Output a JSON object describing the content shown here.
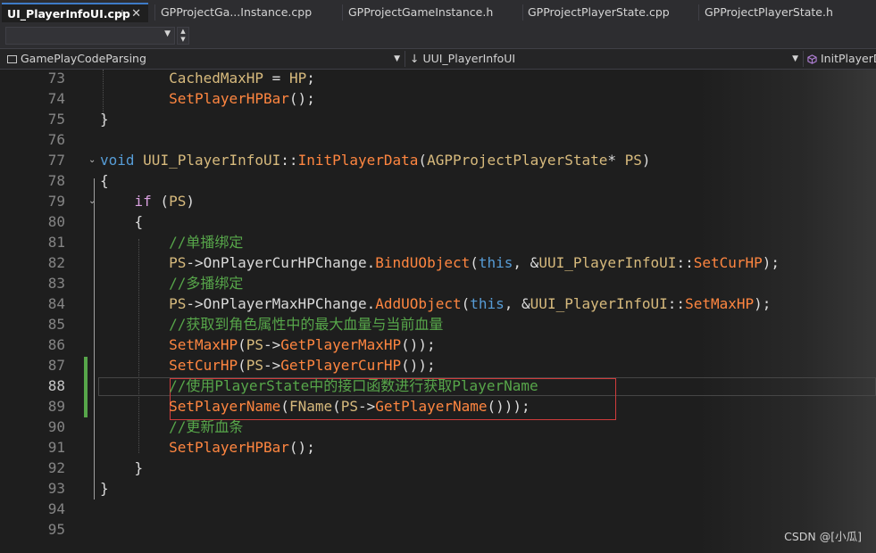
{
  "tabs": [
    {
      "label": "UI_PlayerInfoUI.cpp",
      "active": true
    },
    {
      "label": "GPProjectGa...Instance.cpp"
    },
    {
      "label": "GPProjectGameInstance.h"
    },
    {
      "label": "GPProjectPlayerState.cpp"
    },
    {
      "label": "GPProjectPlayerState.h"
    }
  ],
  "tab_icons": {
    "pin": "⊣",
    "close": "✕"
  },
  "navbar": {
    "project": "GamePlayCodeParsing",
    "scope": "↓ UUI_PlayerInfoUI",
    "member": "InitPlayerD"
  },
  "editor": {
    "lines": [
      {
        "n": "73",
        "tokens": [
          [
            "",
            "        "
          ],
          [
            "t-var",
            "CachedMaxHP"
          ],
          [
            "",
            " = "
          ],
          [
            "t-var",
            "HP"
          ],
          [
            "",
            ";"
          ]
        ]
      },
      {
        "n": "74",
        "tokens": [
          [
            "",
            "        "
          ],
          [
            "t-fn",
            "SetPlayerHPBar"
          ],
          [
            "",
            "();"
          ]
        ]
      },
      {
        "n": "75",
        "tokens": [
          [
            "",
            "}"
          ]
        ]
      },
      {
        "n": "76",
        "tokens": []
      },
      {
        "n": "77",
        "fold": true,
        "tokens": [
          [
            "t-kw",
            "void"
          ],
          [
            "",
            " "
          ],
          [
            "t-type",
            "UUI_PlayerInfoUI"
          ],
          [
            "",
            "::"
          ],
          [
            "t-fn",
            "InitPlayerData"
          ],
          [
            "",
            "("
          ],
          [
            "t-type",
            "AGPProjectPlayerState"
          ],
          [
            "",
            "* "
          ],
          [
            "t-var",
            "PS"
          ],
          [
            "",
            ")"
          ]
        ]
      },
      {
        "n": "78",
        "tokens": [
          [
            "",
            "{"
          ]
        ]
      },
      {
        "n": "79",
        "fold": true,
        "tokens": [
          [
            "",
            "    "
          ],
          [
            "t-kwp",
            "if"
          ],
          [
            "",
            " ("
          ],
          [
            "t-var",
            "PS"
          ],
          [
            "",
            ")"
          ]
        ]
      },
      {
        "n": "80",
        "tokens": [
          [
            "",
            "    {"
          ]
        ]
      },
      {
        "n": "81",
        "tokens": [
          [
            "",
            "        "
          ],
          [
            "t-cmt",
            "//单播绑定"
          ]
        ]
      },
      {
        "n": "82",
        "tokens": [
          [
            "",
            "        "
          ],
          [
            "t-var",
            "PS"
          ],
          [
            "",
            "->"
          ],
          [
            "t-mem",
            "OnPlayerCurHPChange"
          ],
          [
            "",
            "."
          ],
          [
            "t-fn",
            "BindUObject"
          ],
          [
            "",
            "("
          ],
          [
            "t-kw",
            "this"
          ],
          [
            "",
            ", &"
          ],
          [
            "t-type",
            "UUI_PlayerInfoUI"
          ],
          [
            "",
            "::"
          ],
          [
            "t-fn",
            "SetCurHP"
          ],
          [
            "",
            ");"
          ]
        ]
      },
      {
        "n": "83",
        "tokens": [
          [
            "",
            "        "
          ],
          [
            "t-cmt",
            "//多播绑定"
          ]
        ]
      },
      {
        "n": "84",
        "tokens": [
          [
            "",
            "        "
          ],
          [
            "t-var",
            "PS"
          ],
          [
            "",
            "->"
          ],
          [
            "t-mem",
            "OnPlayerMaxHPChange"
          ],
          [
            "",
            "."
          ],
          [
            "t-fn",
            "AddUObject"
          ],
          [
            "",
            "("
          ],
          [
            "t-kw",
            "this"
          ],
          [
            "",
            ", &"
          ],
          [
            "t-type",
            "UUI_PlayerInfoUI"
          ],
          [
            "",
            "::"
          ],
          [
            "t-fn",
            "SetMaxHP"
          ],
          [
            "",
            ");"
          ]
        ]
      },
      {
        "n": "85",
        "tokens": [
          [
            "",
            "        "
          ],
          [
            "t-cmt",
            "//获取到角色属性中的最大血量与当前血量"
          ]
        ]
      },
      {
        "n": "86",
        "tokens": [
          [
            "",
            "        "
          ],
          [
            "t-fn",
            "SetMaxHP"
          ],
          [
            "",
            "("
          ],
          [
            "t-var",
            "PS"
          ],
          [
            "",
            "->"
          ],
          [
            "t-fn",
            "GetPlayerMaxHP"
          ],
          [
            "",
            "());"
          ]
        ]
      },
      {
        "n": "87",
        "tokens": [
          [
            "",
            "        "
          ],
          [
            "t-fn",
            "SetCurHP"
          ],
          [
            "",
            "("
          ],
          [
            "t-var",
            "PS"
          ],
          [
            "",
            "->"
          ],
          [
            "t-fn",
            "GetPlayerCurHP"
          ],
          [
            "",
            "());"
          ]
        ]
      },
      {
        "n": "88",
        "current": true,
        "tokens": [
          [
            "",
            "        "
          ],
          [
            "t-cmt",
            "//使用PlayerState中的接口函数进行获取PlayerName"
          ]
        ]
      },
      {
        "n": "89",
        "tokens": [
          [
            "",
            "        "
          ],
          [
            "t-fn",
            "SetPlayerName"
          ],
          [
            "",
            "("
          ],
          [
            "t-type",
            "FName"
          ],
          [
            "",
            "("
          ],
          [
            "t-var",
            "PS"
          ],
          [
            "",
            "->"
          ],
          [
            "t-fn",
            "GetPlayerName"
          ],
          [
            "",
            "()));"
          ]
        ]
      },
      {
        "n": "90",
        "tokens": [
          [
            "",
            "        "
          ],
          [
            "t-cmt",
            "//更新血条"
          ]
        ]
      },
      {
        "n": "91",
        "tokens": [
          [
            "",
            "        "
          ],
          [
            "t-fn",
            "SetPlayerHPBar"
          ],
          [
            "",
            "();"
          ]
        ]
      },
      {
        "n": "92",
        "tokens": [
          [
            "",
            "    }"
          ]
        ]
      },
      {
        "n": "93",
        "tokens": [
          [
            "",
            "}"
          ]
        ]
      },
      {
        "n": "94",
        "tokens": []
      },
      {
        "n": "95",
        "tokens": []
      }
    ]
  },
  "watermark": "CSDN @[小瓜]",
  "colors": {
    "keyword": "#569cd6",
    "control_keyword": "#d8a0df",
    "type": "#d7ba7d",
    "function": "#ff8640",
    "comment": "#57a64a",
    "highlight_box": "#d03c3c",
    "change_bar": "#57a64a"
  }
}
